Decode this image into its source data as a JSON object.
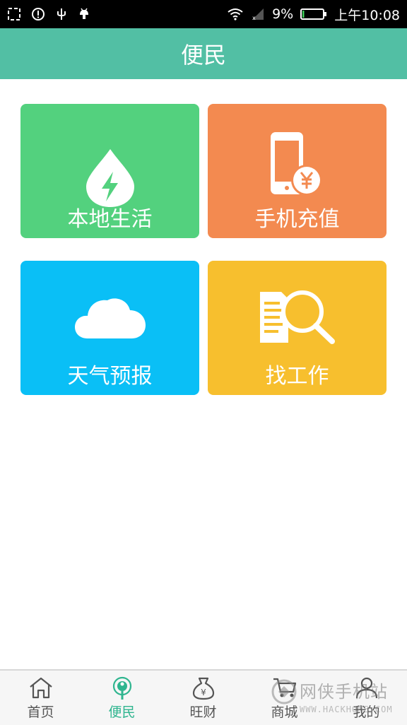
{
  "status_bar": {
    "left_icons": [
      "screenshot-icon",
      "alert-icon",
      "usb-icon",
      "android-debug-icon"
    ],
    "battery_percent": "9%",
    "time": "上午10:08",
    "battery_level": 0.09
  },
  "header": {
    "title": "便民"
  },
  "tiles": [
    {
      "label": "本地生活",
      "icon": "water-drop-bolt-icon",
      "color": "#53d17e"
    },
    {
      "label": "手机充值",
      "icon": "phone-yen-icon",
      "color": "#f38a50"
    },
    {
      "label": "天气预报",
      "icon": "cloud-icon",
      "color": "#0abff6"
    },
    {
      "label": "找工作",
      "icon": "document-search-icon",
      "color": "#f7bf2e"
    }
  ],
  "bottom_nav": {
    "active": "便民",
    "accent": "#2fb58f",
    "items": [
      {
        "label": "首页",
        "icon": "home-icon"
      },
      {
        "label": "便民",
        "icon": "location-pin-icon"
      },
      {
        "label": "旺财",
        "icon": "money-bag-icon"
      },
      {
        "label": "商城",
        "icon": "shopping-cart-icon"
      },
      {
        "label": "我的",
        "icon": "user-icon"
      }
    ]
  },
  "watermark": {
    "text": "网侠手机站",
    "url": "WWW.HACKHOME.COM"
  }
}
